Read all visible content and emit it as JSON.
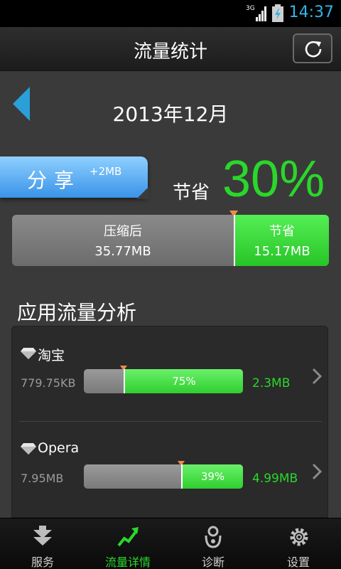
{
  "status_bar": {
    "time": "14:37",
    "network": "3G"
  },
  "header": {
    "title": "流量统计",
    "refresh_icon": "refresh-icon"
  },
  "period": {
    "label": "2013年12月",
    "prev_icon": "triangle-left-icon"
  },
  "share": {
    "label": "分享",
    "bonus": "+2MB"
  },
  "savings": {
    "label": "节省",
    "percent_text": "30%",
    "percent": 30
  },
  "summary": {
    "compressed_label": "压缩后",
    "compressed_value": "35.77MB",
    "saved_label": "节省",
    "saved_value": "15.17MB",
    "compressed_fraction": 0.7
  },
  "section": {
    "title": "应用流量分析"
  },
  "apps": [
    {
      "name": "淘宝",
      "compressed": "779.75KB",
      "percent_text": "75%",
      "percent": 75,
      "saved": "2.3MB",
      "icon": "diamond-icon"
    },
    {
      "name": "Opera",
      "compressed": "7.95MB",
      "percent_text": "39%",
      "percent": 39,
      "saved": "4.99MB",
      "icon": "diamond-icon"
    }
  ],
  "nav": [
    {
      "label": "服务",
      "icon": "download-arrows-icon",
      "active": false
    },
    {
      "label": "流量详情",
      "icon": "trend-up-icon",
      "active": true
    },
    {
      "label": "诊断",
      "icon": "stethoscope-icon",
      "active": false
    },
    {
      "label": "设置",
      "icon": "gear-icon",
      "active": false
    }
  ],
  "colors": {
    "accent_green": "#2ad72a",
    "share_blue": "#3a93e8",
    "marker_orange": "#f08a4b",
    "time_blue": "#33b5e5"
  }
}
